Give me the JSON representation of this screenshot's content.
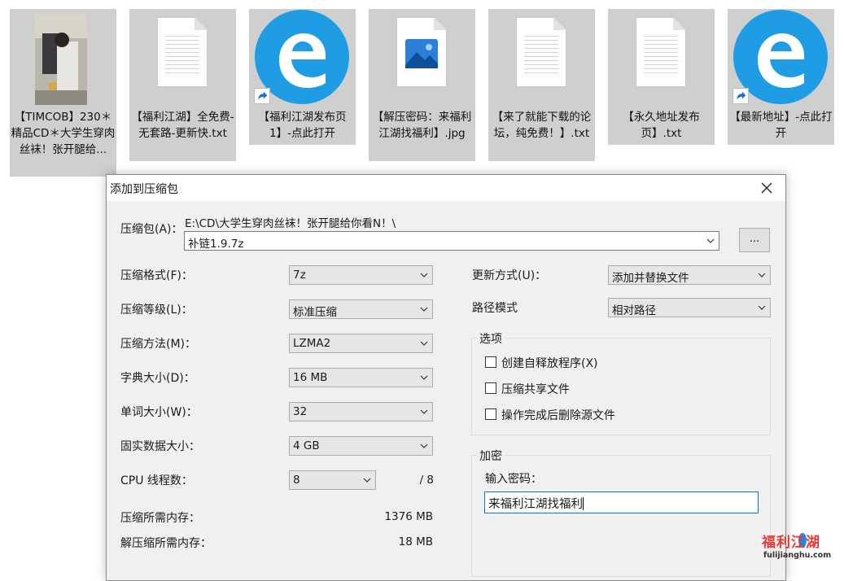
{
  "desktop": {
    "files": [
      {
        "label": "【TIMCOB】230＊精品CD＊大学生穿肉丝袜！张开腿给...",
        "kind": "image-thumbnail"
      },
      {
        "label": "【福利江湖】全免费-无套路-更新快.txt",
        "kind": "text-document-icon"
      },
      {
        "label": "【福利江湖发布页1】-点此打开",
        "kind": "edge-shortcut-icon"
      },
      {
        "label": "【解压密码：来福利江湖找福利】.jpg",
        "kind": "image-file-icon"
      },
      {
        "label": "【来了就能下载的论坛，纯免费！】.txt",
        "kind": "text-document-icon"
      },
      {
        "label": "【永久地址发布页】.txt",
        "kind": "text-document-icon"
      },
      {
        "label": "【最新地址】-点此打开",
        "kind": "edge-shortcut-icon"
      }
    ]
  },
  "dialog": {
    "title": "添加到压缩包",
    "archive_label": "压缩包(A)：",
    "archive_path": "E:\\CD\\大学生穿肉丝袜！张开腿给你看N！\\",
    "archive_name": "补链1.9.7z",
    "browse_label": "...",
    "format_label": "压缩格式(F)：",
    "format_value": "7z",
    "level_label": "压缩等级(L)：",
    "level_value": "标准压缩",
    "method_label": "压缩方法(M)：",
    "method_value": "LZMA2",
    "dict_label": "字典大小(D)：",
    "dict_value": "16 MB",
    "word_label": "单词大小(W)：",
    "word_value": "32",
    "solid_label": "固实数据大小：",
    "solid_value": "4 GB",
    "cpu_label": "CPU 线程数：",
    "cpu_value": "8",
    "cpu_total": "/ 8",
    "mem_comp_label": "压缩所需内存：",
    "mem_comp_value": "1376 MB",
    "mem_decomp_label": "解压缩所需内存：",
    "mem_decomp_value": "18 MB",
    "update_label": "更新方式(U)：",
    "update_value": "添加并替换文件",
    "path_label": "路径模式",
    "path_value": "相对路径",
    "options_title": "选项",
    "opt_sfx": "创建自释放程序(X)",
    "opt_shared": "压缩共享文件",
    "opt_delete": "操作完成后删除源文件",
    "encrypt_title": "加密",
    "password_label": "输入密码：",
    "password_value": "来福利江湖找福利"
  },
  "watermark": {
    "brand": "福利江湖",
    "domain": "fulijianghu.com"
  },
  "colors": {
    "accent": "#0078d7",
    "edge_blue": "#1f9de4",
    "tile_bg": "#cfcfcf",
    "dialog_bg": "#f0f0f0"
  }
}
